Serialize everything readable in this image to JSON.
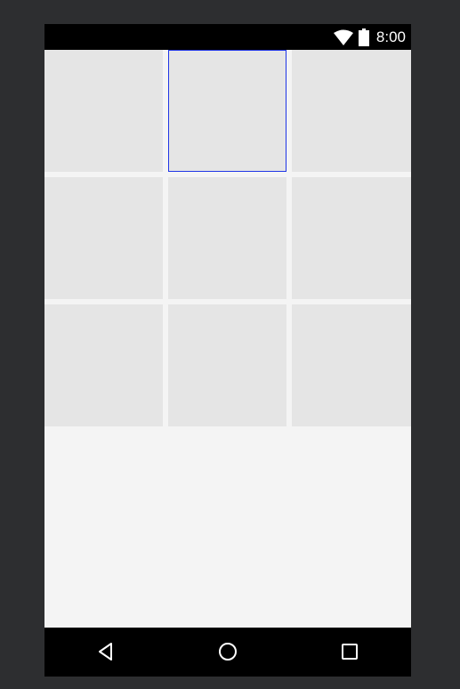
{
  "status_bar": {
    "time": "8:00",
    "icons": [
      "wifi-icon",
      "battery-icon"
    ]
  },
  "grid": {
    "rows": 3,
    "columns": 3,
    "selected_tile": 2
  },
  "nav_bar": {
    "buttons": [
      "back-icon",
      "home-icon",
      "recents-icon"
    ]
  },
  "colors": {
    "screen_background": "#f4f4f4",
    "tile": "#e5e5e5",
    "selection_outline": "#1f35e6",
    "bars": "#000000",
    "frame": "#2d2e30"
  }
}
